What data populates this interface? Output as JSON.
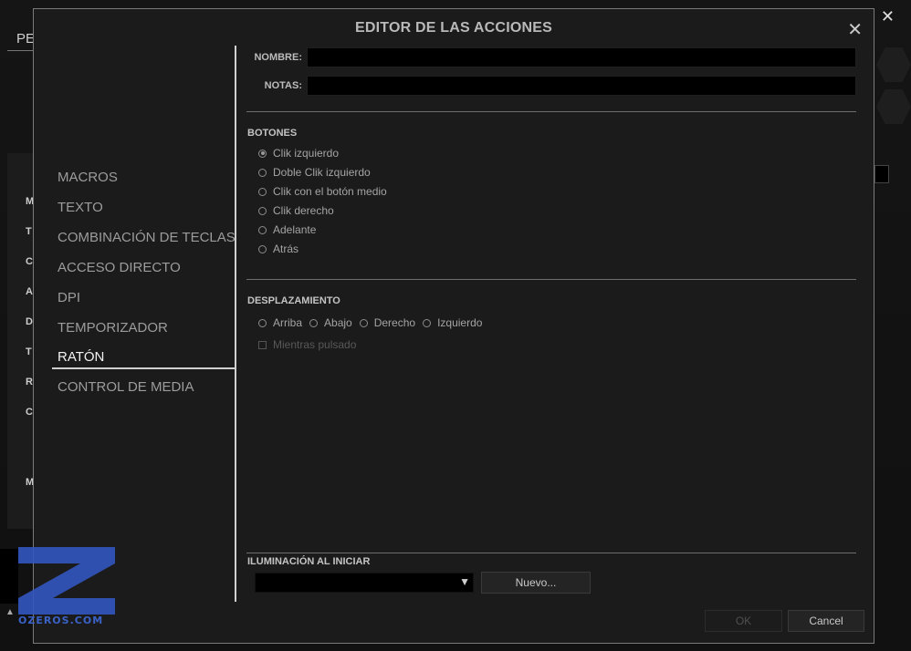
{
  "background": {
    "tab_label": "PE",
    "side_letters": [
      "M",
      "T",
      "C",
      "A",
      "D",
      "T",
      "R",
      "C",
      "M"
    ],
    "close_glyph": "✕",
    "arrow_glyph": "▲"
  },
  "watermark": {
    "text": "OZEROS.COM",
    "color": "#3a62c8"
  },
  "dialog": {
    "title": "EDITOR DE LAS ACCIONES",
    "close_glyph": "✕",
    "nav": [
      {
        "label": "MACROS"
      },
      {
        "label": "TEXTO"
      },
      {
        "label": "COMBINACIÓN DE TECLAS"
      },
      {
        "label": "ACCESO DIRECTO"
      },
      {
        "label": "DPI"
      },
      {
        "label": "TEMPORIZADOR"
      },
      {
        "label": "RATÓN"
      },
      {
        "label": "CONTROL DE MEDIA"
      }
    ],
    "active_nav": "RATÓN",
    "fields": {
      "name_label": "NOMBRE:",
      "name_value": "",
      "notes_label": "NOTAS:",
      "notes_value": ""
    },
    "buttons_section": {
      "title": "BOTONES",
      "options": [
        {
          "label": "Clik izquierdo",
          "checked": true
        },
        {
          "label": "Doble Clik izquierdo",
          "checked": false
        },
        {
          "label": "Clik con el botón medio",
          "checked": false
        },
        {
          "label": "Clik derecho",
          "checked": false
        },
        {
          "label": "Adelante",
          "checked": false
        },
        {
          "label": "Atrás",
          "checked": false
        }
      ]
    },
    "scroll_section": {
      "title": "DESPLAZAMIENTO",
      "options": [
        {
          "label": "Arriba"
        },
        {
          "label": "Abajo"
        },
        {
          "label": "Derecho"
        },
        {
          "label": "Izquierdo"
        }
      ],
      "hold_label": "Mientras pulsado"
    },
    "lighting": {
      "title": "ILUMINACIÓN AL INICIAR",
      "selected": "",
      "arrow_glyph": "▼",
      "new_button": "Nuevo..."
    },
    "footer": {
      "ok_label": "OK",
      "cancel_label": "Cancel"
    }
  }
}
